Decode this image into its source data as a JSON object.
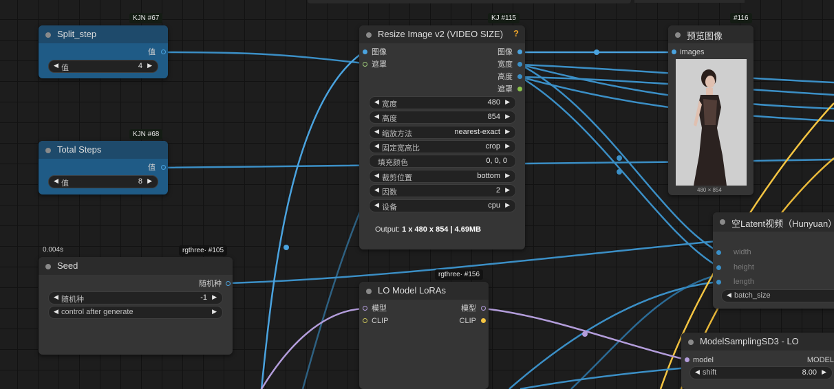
{
  "nodes": {
    "split_step": {
      "badge": "KJN  #67",
      "title": "Split_step",
      "out_label": "值",
      "widget_label": "值",
      "widget_value": "4"
    },
    "total_steps": {
      "badge": "KJN  #68",
      "title": "Total Steps",
      "out_label": "值",
      "widget_label": "值",
      "widget_value": "8"
    },
    "seed": {
      "timer": "0.004s",
      "badge": "rgthree·  #105",
      "title": "Seed",
      "out_label": "随机种",
      "widgets": [
        {
          "label": "随机种",
          "value": "-1"
        },
        {
          "label": "control after generate",
          "value": ""
        }
      ]
    },
    "resize": {
      "badge": "KJ  #115",
      "title": "Resize Image v2 (VIDEO SIZE)",
      "help": "?",
      "inputs": [
        "图像",
        "遮罩"
      ],
      "outputs": [
        "图像",
        "宽度",
        "高度",
        "遮罩"
      ],
      "widgets": [
        {
          "label": "宽度",
          "value": "480"
        },
        {
          "label": "高度",
          "value": "854"
        },
        {
          "label": "缩放方法",
          "value": "nearest-exact"
        },
        {
          "label": "固定宽高比",
          "value": "crop"
        },
        {
          "label": "填充颜色",
          "value": "0, 0, 0"
        },
        {
          "label": "裁剪位置",
          "value": "bottom"
        },
        {
          "label": "因数",
          "value": "2"
        },
        {
          "label": "设备",
          "value": "cpu"
        }
      ],
      "output_prefix": "Output: ",
      "output_detail": "1 x 480 x 854 | 4.69MB"
    },
    "preview": {
      "badge": "#116",
      "title": "预览图像",
      "input": "images",
      "caption": "480 × 854"
    },
    "latent": {
      "title": "空Latent视频（Hunyuan）",
      "inputs": [
        "width",
        "height",
        "length"
      ],
      "widget_label": "batch_size"
    },
    "lora": {
      "badge": "rgthree·  #156",
      "title": "LO Model LoRAs",
      "inputs": [
        "模型",
        "CLIP"
      ],
      "outputs": [
        "模型",
        "CLIP"
      ]
    },
    "msd3": {
      "title": "ModelSamplingSD3 - LO",
      "input": "model",
      "output": "MODEL",
      "widget_label": "shift",
      "widget_value": "8.00"
    }
  },
  "colors": {
    "image_link": "#4aa3df",
    "int_link": "#3a8fc7",
    "model_link": "#b39ddb",
    "clip_link": "#f5c542",
    "mask_link": "#8bc34a",
    "blue_node": "#1f5b86"
  }
}
